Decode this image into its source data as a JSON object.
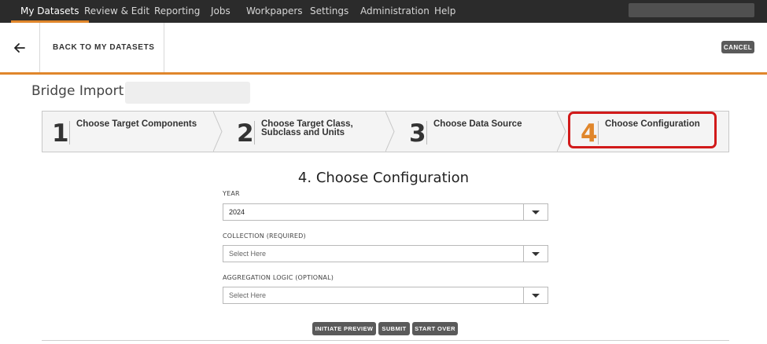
{
  "nav": {
    "items": [
      "My Datasets",
      "Review & Edit",
      "Reporting",
      "Jobs",
      "Workpapers",
      "Settings",
      "Administration",
      "Help"
    ],
    "active": "My Datasets"
  },
  "backbar": {
    "back_label": "BACK TO MY DATASETS",
    "cancel_label": "CANCEL"
  },
  "page": {
    "title": "Bridge Import -"
  },
  "steps": [
    {
      "num": "1",
      "label": "Choose Target Components"
    },
    {
      "num": "2",
      "label": "Choose Target Class, Subclass and Units"
    },
    {
      "num": "3",
      "label": "Choose Data Source"
    },
    {
      "num": "4",
      "label": "Choose Configuration"
    }
  ],
  "form": {
    "heading": "4. Choose Configuration",
    "year_label": "YEAR",
    "year_value": "2024",
    "collection_label": "COLLECTION (REQUIRED)",
    "collection_placeholder": "Select Here",
    "aggregation_label": "AGGREGATION LOGIC (OPTIONAL)",
    "aggregation_placeholder": "Select Here"
  },
  "actions": {
    "preview": "INITIATE PREVIEW",
    "submit": "SUBMIT",
    "start_over": "START OVER"
  },
  "colors": {
    "accent": "#e0862b",
    "highlight": "#d11a1a",
    "nav_bg": "#2b2b2b"
  }
}
